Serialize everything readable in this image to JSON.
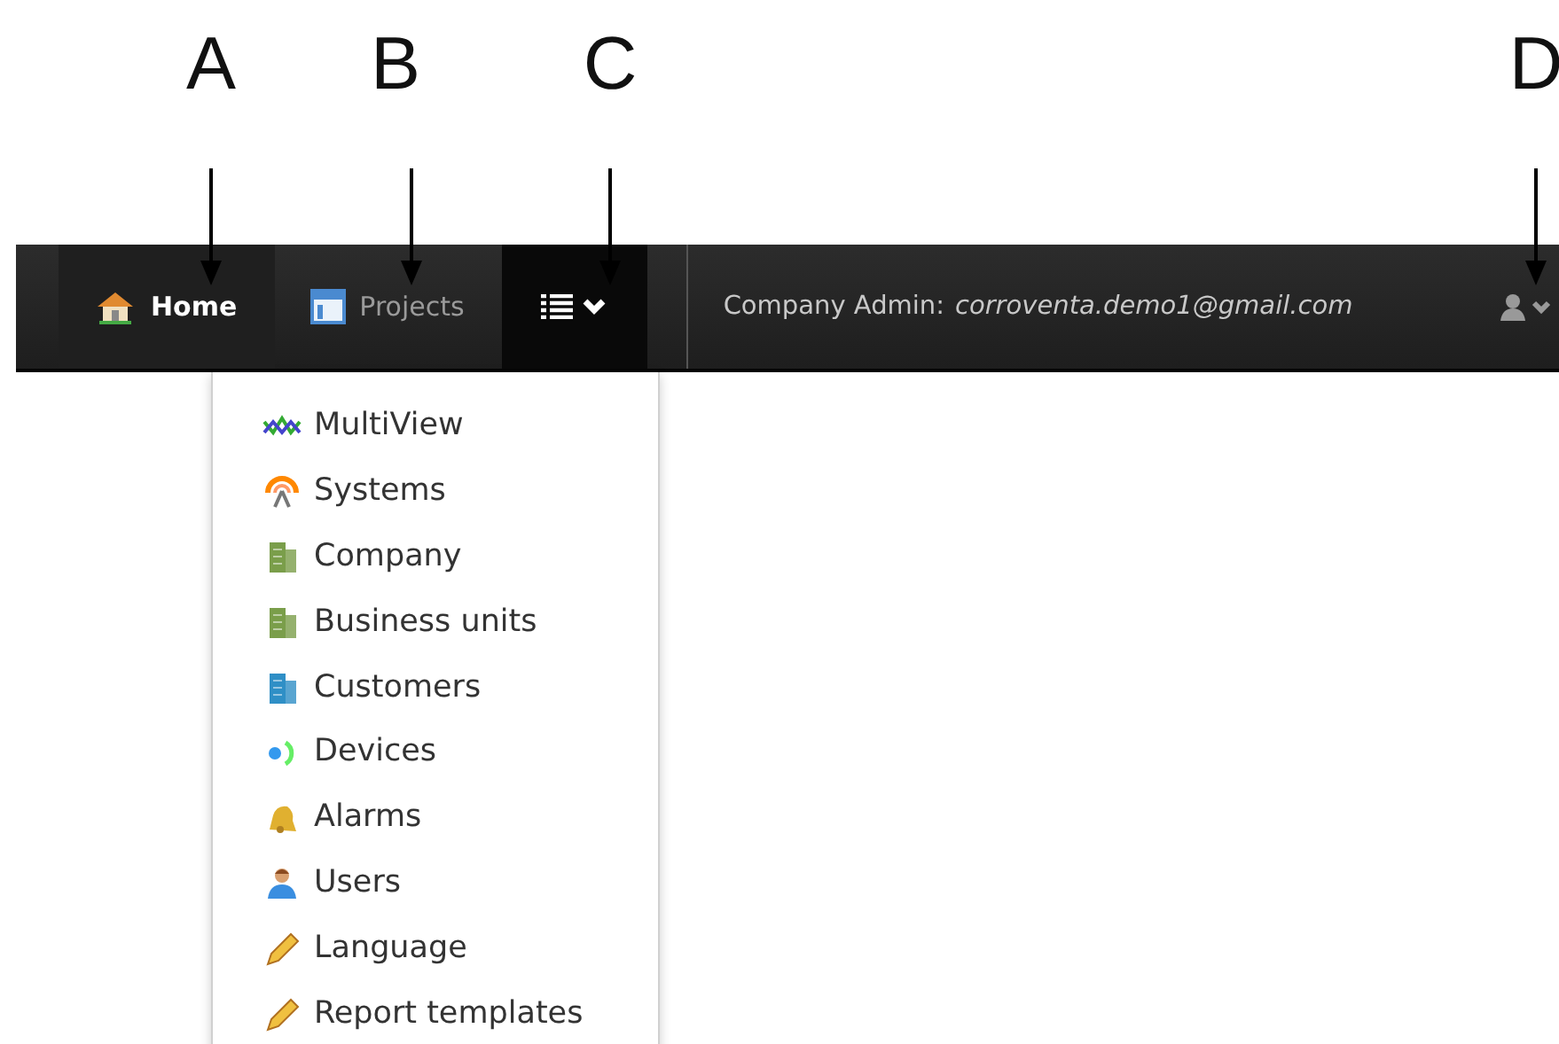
{
  "annotations": [
    {
      "label": "A"
    },
    {
      "label": "B"
    },
    {
      "label": "C"
    },
    {
      "label": "D"
    }
  ],
  "nav": {
    "items": [
      {
        "kind": "home",
        "label": "Home",
        "selected": true
      },
      {
        "kind": "projects",
        "label": "Projects",
        "selected": false
      }
    ],
    "menu_button": {
      "expanded": true
    },
    "account": {
      "role": "Company Admin:",
      "email": "corroventa.demo1@gmail.com"
    }
  },
  "menu": [
    {
      "kind": "chart",
      "label": "MultiView"
    },
    {
      "kind": "antenna",
      "label": "Systems"
    },
    {
      "kind": "building-green",
      "label": "Company"
    },
    {
      "kind": "building-green",
      "label": "Business units"
    },
    {
      "kind": "building-blue",
      "label": "Customers"
    },
    {
      "kind": "signal",
      "label": "Devices"
    },
    {
      "kind": "bell",
      "label": "Alarms"
    },
    {
      "kind": "user",
      "label": "Users"
    },
    {
      "kind": "pencil",
      "label": "Language"
    },
    {
      "kind": "pencil",
      "label": "Report templates"
    }
  ]
}
